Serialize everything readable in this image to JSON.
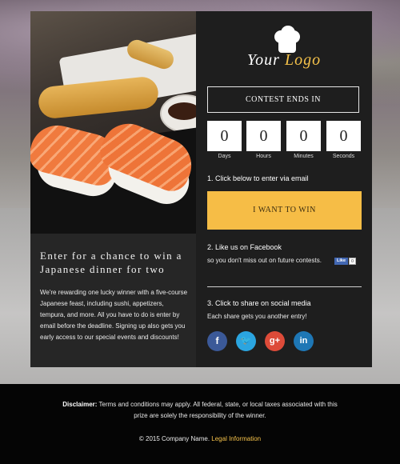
{
  "logo": {
    "word1": "Your",
    "word2": "Logo"
  },
  "headline": "Enter for a chance to win a Japanese dinner for two",
  "description": "We're rewarding one lucky winner with a five-course Japanese feast, including sushi, appetizers, tempura, and more. All you have to do is enter by email before the deadline. Signing up also gets you early access to our special events and discounts!",
  "contest_label": "CONTEST ENDS IN",
  "countdown": [
    {
      "value": "0",
      "label": "Days"
    },
    {
      "value": "0",
      "label": "Hours"
    },
    {
      "value": "0",
      "label": "Minutes"
    },
    {
      "value": "0",
      "label": "Seconds"
    }
  ],
  "step1": {
    "title": "1. Click below to enter via email",
    "button": "I WANT TO WIN"
  },
  "step2": {
    "title": "2. Like us on Facebook",
    "text": "so you don't miss out on future contests.",
    "like": "Like",
    "count": "0"
  },
  "step3": {
    "title": "3. Click to share on social media",
    "text": "Each share gets you another entry!"
  },
  "social": [
    {
      "name": "facebook",
      "glyph": "f",
      "color": "#3b5998"
    },
    {
      "name": "twitter",
      "glyph": "🐦",
      "color": "#2ba5e0"
    },
    {
      "name": "google-plus",
      "glyph": "g+",
      "color": "#dd4b39"
    },
    {
      "name": "linkedin",
      "glyph": "in",
      "color": "#1e77b5"
    }
  ],
  "footer": {
    "disclaimer_label": "Disclaimer:",
    "disclaimer_text": "Terms and conditions may apply. All federal, state, or local taxes associated with this prize are solely the responsibility of the winner.",
    "copyright": "© 2015 Company Name.",
    "legal_link": "Legal Information"
  }
}
